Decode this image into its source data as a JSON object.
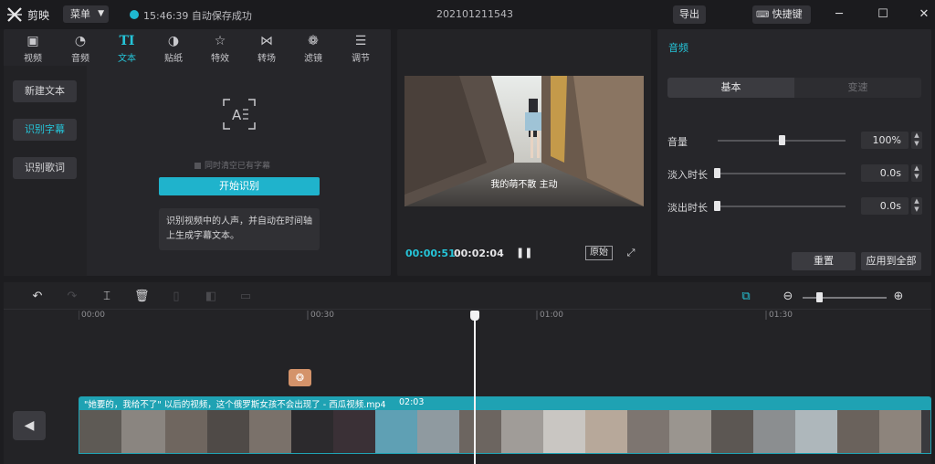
{
  "titlebar": {
    "app_name": "剪映",
    "menu_label": "菜单",
    "save_status": "15:46:39 自动保存成功",
    "project_title": "202101211543",
    "export_label": "导出",
    "shortcut_label": "快捷键"
  },
  "tabs": [
    {
      "label": "视频",
      "icon": "video-icon"
    },
    {
      "label": "音频",
      "icon": "audio-icon"
    },
    {
      "label": "文本",
      "icon": "text-icon",
      "active": true
    },
    {
      "label": "贴纸",
      "icon": "sticker-icon"
    },
    {
      "label": "特效",
      "icon": "effects-icon"
    },
    {
      "label": "转场",
      "icon": "transition-icon"
    },
    {
      "label": "滤镜",
      "icon": "filter-icon"
    },
    {
      "label": "调节",
      "icon": "adjust-icon"
    }
  ],
  "sidebar": {
    "items": [
      {
        "label": "新建文本"
      },
      {
        "label": "识别字幕",
        "active": true
      },
      {
        "label": "识别歌词"
      }
    ]
  },
  "recognize": {
    "checkbox_label": "同时清空已有字幕",
    "start_label": "开始识别",
    "description": "识别视频中的人声，并自动在时间轴上生成字幕文本。"
  },
  "preview": {
    "subtitle": "我的萌不散 主动",
    "current_time": "00:00:51",
    "total_time": "00:02:04",
    "original_label": "原始"
  },
  "audio_panel": {
    "title": "音频",
    "tab_basic": "基本",
    "tab_speed": "变速",
    "volume_label": "音量",
    "volume_value": "100%",
    "volume_level": 0.5,
    "fadein_label": "淡入时长",
    "fadein_value": "0.0s",
    "fadeout_label": "淡出时长",
    "fadeout_value": "0.0s",
    "reset_label": "重置",
    "apply_all_label": "应用到全部"
  },
  "timeline": {
    "ticks": [
      "00:00",
      "00:30",
      "01:00",
      "01:30"
    ],
    "clip_name": "\"她要的，我给不了\" 以后的视频，这个俄罗斯女孩不会出现了 - 西瓜视频.mp4",
    "clip_duration": "02:03",
    "marker_icon": "palette-icon"
  },
  "colors": {
    "accent": "#25c4d8",
    "track": "#1fa2b3",
    "marker": "#d4936a"
  }
}
